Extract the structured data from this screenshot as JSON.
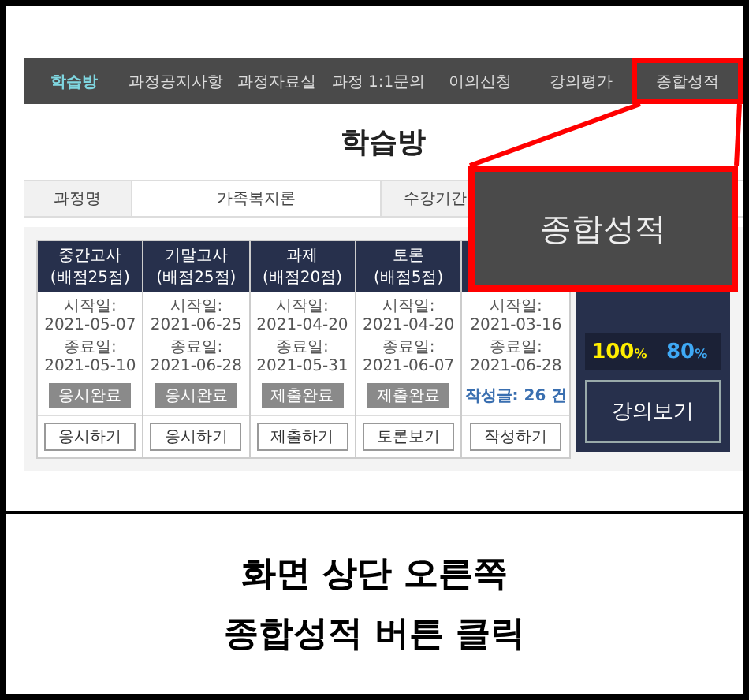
{
  "nav": {
    "items": [
      {
        "label": "학습방",
        "selected": true,
        "highlighted": false
      },
      {
        "label": "과정공지사항",
        "selected": false,
        "highlighted": false
      },
      {
        "label": "과정자료실",
        "selected": false,
        "highlighted": false
      },
      {
        "label": "과정 1:1문의",
        "selected": false,
        "highlighted": false
      },
      {
        "label": "이의신청",
        "selected": false,
        "highlighted": false
      },
      {
        "label": "강의평가",
        "selected": false,
        "highlighted": false
      },
      {
        "label": "종합성적",
        "selected": false,
        "highlighted": true
      }
    ]
  },
  "page_title": "학습방",
  "course_info": {
    "cells": [
      {
        "kind": "label",
        "text": "과정명"
      },
      {
        "kind": "value",
        "text": "가족복지론"
      },
      {
        "kind": "label",
        "text": "수강기간"
      }
    ]
  },
  "cards": [
    {
      "title": "중간고사",
      "subtitle": "(배점25점)",
      "start": "시작일: 2021-05-07",
      "end": "종료일: 2021-05-10",
      "status": {
        "kind": "status",
        "text": "응시완료"
      },
      "action": "응시하기"
    },
    {
      "title": "기말고사",
      "subtitle": "(배점25점)",
      "start": "시작일: 2021-06-25",
      "end": "종료일: 2021-06-28",
      "status": {
        "kind": "status",
        "text": "응시완료"
      },
      "action": "응시하기"
    },
    {
      "title": "과제",
      "subtitle": "(배점20점)",
      "start": "시작일: 2021-04-20",
      "end": "종료일: 2021-05-31",
      "status": {
        "kind": "status",
        "text": "제출완료"
      },
      "action": "제출하기"
    },
    {
      "title": "토론",
      "subtitle": "(배점5점)",
      "start": "시작일: 2021-04-20",
      "end": "종료일: 2021-06-07",
      "status": {
        "kind": "status",
        "text": "제출완료"
      },
      "action": "토론보기"
    },
    {
      "start": "시작일: 2021-03-16",
      "end": "종료일: 2021-06-28",
      "status": {
        "kind": "count",
        "text": "작성글: 26 건"
      },
      "action": "작성하기"
    }
  ],
  "summary": {
    "scores": [
      {
        "value": "100",
        "unit": "%",
        "color": "#ffee00"
      },
      {
        "value": "80",
        "unit": "%",
        "color": "#3fa9f5"
      }
    ],
    "button": "강의보기"
  },
  "callout": {
    "label": "종합성적"
  },
  "caption": [
    "화면 상단 오른쪽",
    "종합성적 버튼 클릭"
  ]
}
